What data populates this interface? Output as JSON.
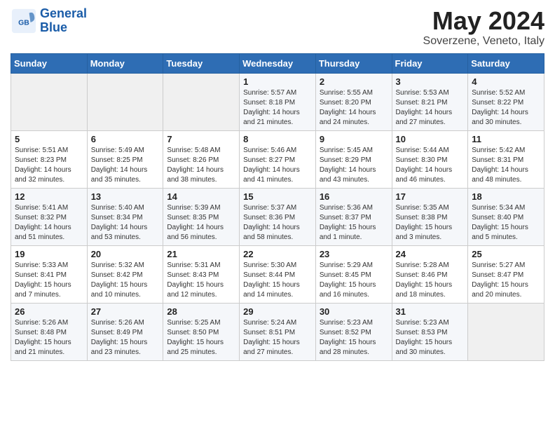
{
  "header": {
    "logo_general": "General",
    "logo_blue": "Blue",
    "month": "May 2024",
    "location": "Soverzene, Veneto, Italy"
  },
  "days_of_week": [
    "Sunday",
    "Monday",
    "Tuesday",
    "Wednesday",
    "Thursday",
    "Friday",
    "Saturday"
  ],
  "weeks": [
    [
      {
        "day": "",
        "info": ""
      },
      {
        "day": "",
        "info": ""
      },
      {
        "day": "",
        "info": ""
      },
      {
        "day": "1",
        "info": "Sunrise: 5:57 AM\nSunset: 8:18 PM\nDaylight: 14 hours\nand 21 minutes."
      },
      {
        "day": "2",
        "info": "Sunrise: 5:55 AM\nSunset: 8:20 PM\nDaylight: 14 hours\nand 24 minutes."
      },
      {
        "day": "3",
        "info": "Sunrise: 5:53 AM\nSunset: 8:21 PM\nDaylight: 14 hours\nand 27 minutes."
      },
      {
        "day": "4",
        "info": "Sunrise: 5:52 AM\nSunset: 8:22 PM\nDaylight: 14 hours\nand 30 minutes."
      }
    ],
    [
      {
        "day": "5",
        "info": "Sunrise: 5:51 AM\nSunset: 8:23 PM\nDaylight: 14 hours\nand 32 minutes."
      },
      {
        "day": "6",
        "info": "Sunrise: 5:49 AM\nSunset: 8:25 PM\nDaylight: 14 hours\nand 35 minutes."
      },
      {
        "day": "7",
        "info": "Sunrise: 5:48 AM\nSunset: 8:26 PM\nDaylight: 14 hours\nand 38 minutes."
      },
      {
        "day": "8",
        "info": "Sunrise: 5:46 AM\nSunset: 8:27 PM\nDaylight: 14 hours\nand 41 minutes."
      },
      {
        "day": "9",
        "info": "Sunrise: 5:45 AM\nSunset: 8:29 PM\nDaylight: 14 hours\nand 43 minutes."
      },
      {
        "day": "10",
        "info": "Sunrise: 5:44 AM\nSunset: 8:30 PM\nDaylight: 14 hours\nand 46 minutes."
      },
      {
        "day": "11",
        "info": "Sunrise: 5:42 AM\nSunset: 8:31 PM\nDaylight: 14 hours\nand 48 minutes."
      }
    ],
    [
      {
        "day": "12",
        "info": "Sunrise: 5:41 AM\nSunset: 8:32 PM\nDaylight: 14 hours\nand 51 minutes."
      },
      {
        "day": "13",
        "info": "Sunrise: 5:40 AM\nSunset: 8:34 PM\nDaylight: 14 hours\nand 53 minutes."
      },
      {
        "day": "14",
        "info": "Sunrise: 5:39 AM\nSunset: 8:35 PM\nDaylight: 14 hours\nand 56 minutes."
      },
      {
        "day": "15",
        "info": "Sunrise: 5:37 AM\nSunset: 8:36 PM\nDaylight: 14 hours\nand 58 minutes."
      },
      {
        "day": "16",
        "info": "Sunrise: 5:36 AM\nSunset: 8:37 PM\nDaylight: 15 hours\nand 1 minute."
      },
      {
        "day": "17",
        "info": "Sunrise: 5:35 AM\nSunset: 8:38 PM\nDaylight: 15 hours\nand 3 minutes."
      },
      {
        "day": "18",
        "info": "Sunrise: 5:34 AM\nSunset: 8:40 PM\nDaylight: 15 hours\nand 5 minutes."
      }
    ],
    [
      {
        "day": "19",
        "info": "Sunrise: 5:33 AM\nSunset: 8:41 PM\nDaylight: 15 hours\nand 7 minutes."
      },
      {
        "day": "20",
        "info": "Sunrise: 5:32 AM\nSunset: 8:42 PM\nDaylight: 15 hours\nand 10 minutes."
      },
      {
        "day": "21",
        "info": "Sunrise: 5:31 AM\nSunset: 8:43 PM\nDaylight: 15 hours\nand 12 minutes."
      },
      {
        "day": "22",
        "info": "Sunrise: 5:30 AM\nSunset: 8:44 PM\nDaylight: 15 hours\nand 14 minutes."
      },
      {
        "day": "23",
        "info": "Sunrise: 5:29 AM\nSunset: 8:45 PM\nDaylight: 15 hours\nand 16 minutes."
      },
      {
        "day": "24",
        "info": "Sunrise: 5:28 AM\nSunset: 8:46 PM\nDaylight: 15 hours\nand 18 minutes."
      },
      {
        "day": "25",
        "info": "Sunrise: 5:27 AM\nSunset: 8:47 PM\nDaylight: 15 hours\nand 20 minutes."
      }
    ],
    [
      {
        "day": "26",
        "info": "Sunrise: 5:26 AM\nSunset: 8:48 PM\nDaylight: 15 hours\nand 21 minutes."
      },
      {
        "day": "27",
        "info": "Sunrise: 5:26 AM\nSunset: 8:49 PM\nDaylight: 15 hours\nand 23 minutes."
      },
      {
        "day": "28",
        "info": "Sunrise: 5:25 AM\nSunset: 8:50 PM\nDaylight: 15 hours\nand 25 minutes."
      },
      {
        "day": "29",
        "info": "Sunrise: 5:24 AM\nSunset: 8:51 PM\nDaylight: 15 hours\nand 27 minutes."
      },
      {
        "day": "30",
        "info": "Sunrise: 5:23 AM\nSunset: 8:52 PM\nDaylight: 15 hours\nand 28 minutes."
      },
      {
        "day": "31",
        "info": "Sunrise: 5:23 AM\nSunset: 8:53 PM\nDaylight: 15 hours\nand 30 minutes."
      },
      {
        "day": "",
        "info": ""
      }
    ]
  ]
}
